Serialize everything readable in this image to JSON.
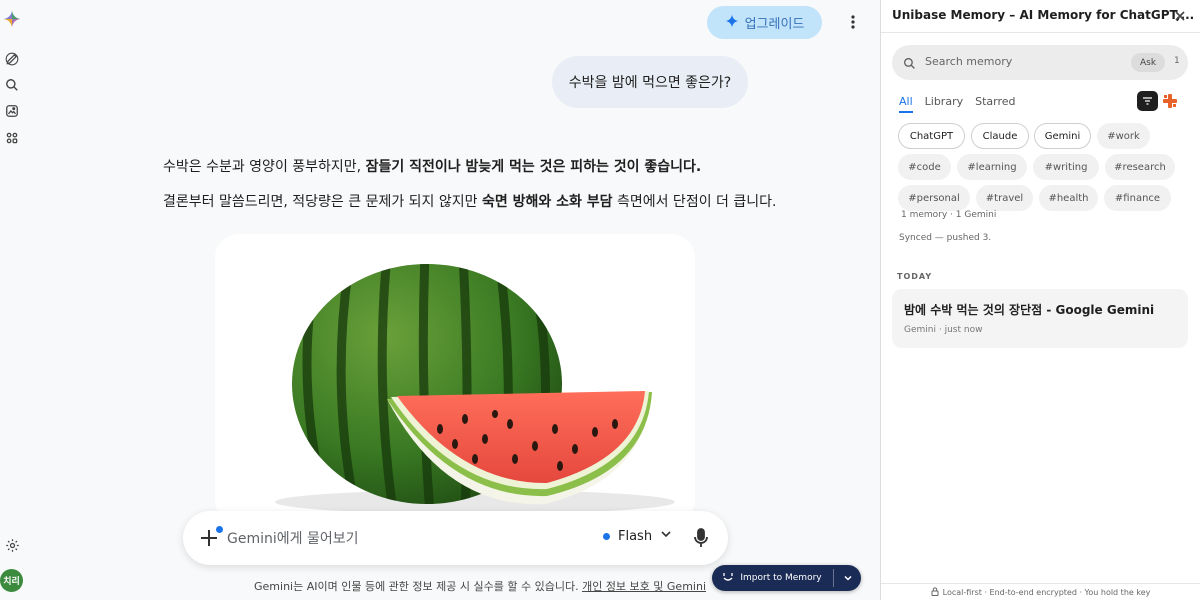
{
  "gemini": {
    "upgrade_label": "업그레이드",
    "user_message": "수박을 밤에 먹으면 좋은가?",
    "answer": {
      "p1_pre": "수박은 수분과 영양이 풍부하지만, ",
      "p1_bold": "잠들기 직전이나 밤늦게 먹는 것은 피하는 것이 좋습니다.",
      "p2_pre": "결론부터 말씀드리면, 적당량은 큰 문제가 되지 않지만 ",
      "p2_bold": "숙면 방해와 소화 부담",
      "p2_post": " 측면에서 단점이 더 큽니다."
    },
    "composer": {
      "placeholder": "Gemini에게 물어보기",
      "model": "Flash"
    },
    "disclaimer": {
      "text": "Gemini는 AI이며 인물 등에 관한 정보 제공 시 실수를 할 수 있습니다. ",
      "link": "개인 정보 보호 및 Gemini"
    },
    "avatar_initials": "치리",
    "icons": {
      "logo": "gemini-sparkle-icon",
      "new_chat": "edit-icon",
      "search": "search-icon",
      "gallery": "image-icon",
      "apps": "apps-icon",
      "settings": "gear-icon",
      "upgrade": "sparkle-icon",
      "menu": "more-vertical-icon",
      "add": "plus-icon",
      "dropdown": "chevron-down-icon",
      "mic": "mic-icon"
    }
  },
  "import_button": {
    "label": "Import to Memory"
  },
  "unibase": {
    "title": "Unibase Memory – AI Memory for ChatGPT,...",
    "search": {
      "placeholder": "Search memory",
      "ask_label": "Ask",
      "shortcut": "1"
    },
    "tabs": [
      {
        "label": "All",
        "active": true
      },
      {
        "label": "Library",
        "active": false
      },
      {
        "label": "Starred",
        "active": false
      }
    ],
    "source_chips": [
      "ChatGPT",
      "Claude",
      "Gemini"
    ],
    "tag_chips": [
      "#work",
      "#code",
      "#learning",
      "#writing",
      "#research",
      "#personal",
      "#travel",
      "#health",
      "#finance"
    ],
    "count_text": "1 memory · 1 Gemini",
    "synced_text": "Synced — pushed 3.",
    "section_label": "TODAY",
    "memories": [
      {
        "title": "밤에 수박 먹는 것의 장단점 - Google Gemini",
        "source": "Gemini",
        "time": "just now"
      }
    ],
    "footer": "Local-first · End-to-end encrypted · You hold the key"
  },
  "colors": {
    "accent_blue": "#1a73e8",
    "upgrade_bg": "#c2e4fb",
    "import_bg": "#1a2b55",
    "avatar_bg": "#3c8a3e"
  }
}
